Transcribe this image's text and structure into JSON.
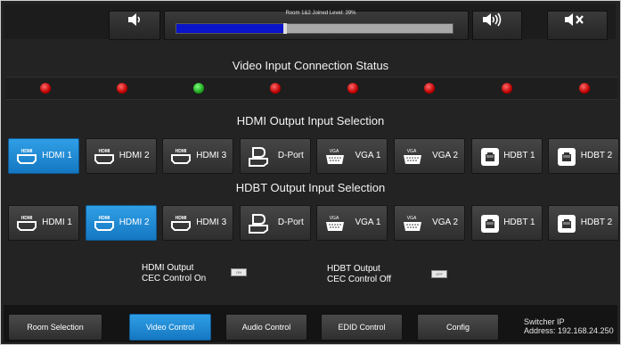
{
  "volume": {
    "title": "Room 1&2 Joined Level: 39%",
    "level_percent": 39
  },
  "sections": {
    "video_status_title": "Video Input Connection Status",
    "hdmi_output_title": "HDMI Output Input Selection",
    "hdbt_output_title": "HDBT Output Input Selection"
  },
  "leds": [
    "off",
    "off",
    "on",
    "off",
    "off",
    "off",
    "off",
    "off"
  ],
  "inputs": [
    {
      "label": "HDMI 1",
      "icon": "hdmi-icon"
    },
    {
      "label": "HDMI 2",
      "icon": "hdmi-icon"
    },
    {
      "label": "HDMI 3",
      "icon": "hdmi-icon"
    },
    {
      "label": "D-Port",
      "icon": "displayport-icon"
    },
    {
      "label": "VGA 1",
      "icon": "vga-icon"
    },
    {
      "label": "VGA 2",
      "icon": "vga-icon"
    },
    {
      "label": "HDBT 1",
      "icon": "hdbt-icon"
    },
    {
      "label": "HDBT 2",
      "icon": "hdbt-icon"
    }
  ],
  "hdmi_row_selected": 0,
  "hdbt_row_selected": 1,
  "icon_texts": {
    "hdmi": "HDMI",
    "vga": "VGA"
  },
  "cec": {
    "hdmi_line1": "HDMI Output",
    "hdmi_line2": "CEC Control On",
    "hdmi_toggle": "ON",
    "hdbt_line1": "HDBT Output",
    "hdbt_line2": "CEC Control Off",
    "hdbt_toggle": "OFF"
  },
  "nav": {
    "room_selection": "Room Selection",
    "video_control": "Video Control",
    "audio_control": "Audio Control",
    "edid_control": "EDID Control",
    "config": "Config",
    "selected": "video_control"
  },
  "switcher": {
    "line1": "Switcher IP",
    "line2": "Address: 192.168.24.250"
  },
  "colors": {
    "selected_blue": "#1f8ad6",
    "volume_fill": "#0a14c8",
    "led_off": "#c00000",
    "led_on": "#1ea51e"
  }
}
